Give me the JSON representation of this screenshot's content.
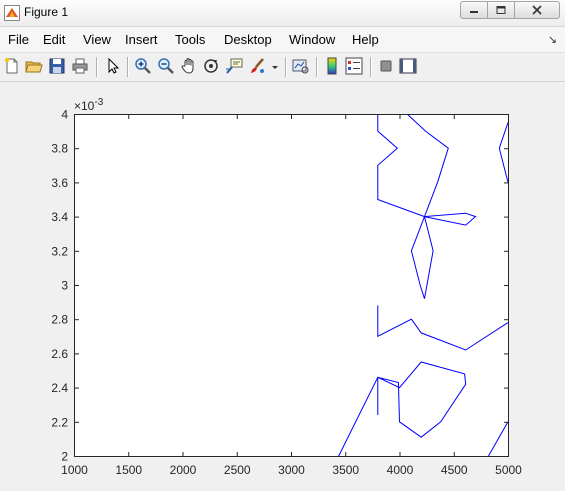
{
  "window": {
    "title": "Figure 1"
  },
  "menu": {
    "items": [
      "File",
      "Edit",
      "View",
      "Insert",
      "Tools",
      "Desktop",
      "Window",
      "Help"
    ],
    "overflow_arrow": "↘"
  },
  "toolbar": {
    "icons": [
      "new-figure-icon",
      "open-file-icon",
      "save-icon",
      "print-icon",
      "pointer-icon",
      "zoom-in-icon",
      "zoom-out-icon",
      "pan-icon",
      "rotate-3d-icon",
      "data-cursor-icon",
      "brush-icon",
      "link-plot-icon",
      "colorbar-icon",
      "legend-icon",
      "hide-plot-tools-icon",
      "show-plot-tools-icon"
    ]
  },
  "chart_data": {
    "type": "line",
    "title": "",
    "xlabel": "",
    "ylabel": "",
    "xlim": [
      1000,
      5000
    ],
    "ylim": [
      0.002,
      0.004
    ],
    "exponent_label": "×10^-3",
    "x_ticks": [
      1000,
      1500,
      2000,
      2500,
      3000,
      3500,
      4000,
      4500,
      5000
    ],
    "x_tick_labels": [
      "1000",
      "1500",
      "2000",
      "2500",
      "3000",
      "3500",
      "4000",
      "4500",
      "5000"
    ],
    "y_ticks": [
      2.0,
      2.2,
      2.4,
      2.6,
      2.8,
      3.0,
      3.2,
      3.4,
      3.6,
      3.8,
      4.0
    ],
    "y_tick_labels": [
      "2",
      "2.2",
      "2.4",
      "2.6",
      "2.8",
      "3",
      "3.2",
      "3.4",
      "3.6",
      "3.8",
      "4"
    ],
    "line_color": "#0000ff",
    "grid": false,
    "series": [
      {
        "x": [
          3800,
          3800,
          3980,
          3800,
          3800,
          4230
        ],
        "y": [
          4.0,
          3.9,
          3.8,
          3.7,
          3.5,
          3.4
        ]
      },
      {
        "x": [
          4070,
          4240,
          4450,
          4350,
          4230,
          4610,
          4700,
          4610,
          4230
        ],
        "y": [
          4.0,
          3.9,
          3.8,
          3.6,
          3.4,
          3.42,
          3.4,
          3.35,
          3.4
        ]
      },
      {
        "x": [
          4230,
          4110,
          4190,
          4230,
          4310,
          4230
        ],
        "y": [
          3.4,
          3.2,
          3.0,
          2.92,
          3.2,
          3.4
        ]
      },
      {
        "x": [
          5000,
          4920,
          5000
        ],
        "y": [
          3.95,
          3.8,
          3.6
        ]
      },
      {
        "x": [
          3800,
          3800,
          4110,
          4200,
          4610,
          5000
        ],
        "y": [
          2.88,
          2.7,
          2.8,
          2.72,
          2.62,
          2.78
        ]
      },
      {
        "x": [
          3800,
          3800,
          4000,
          4200,
          4600,
          4610,
          4380,
          4200,
          4000,
          3990,
          3800,
          3440
        ],
        "y": [
          2.24,
          2.46,
          2.4,
          2.55,
          2.48,
          2.42,
          2.2,
          2.11,
          2.2,
          2.43,
          2.46,
          2.0
        ]
      },
      {
        "x": [
          4820,
          5000
        ],
        "y": [
          2.0,
          2.2
        ]
      }
    ]
  }
}
